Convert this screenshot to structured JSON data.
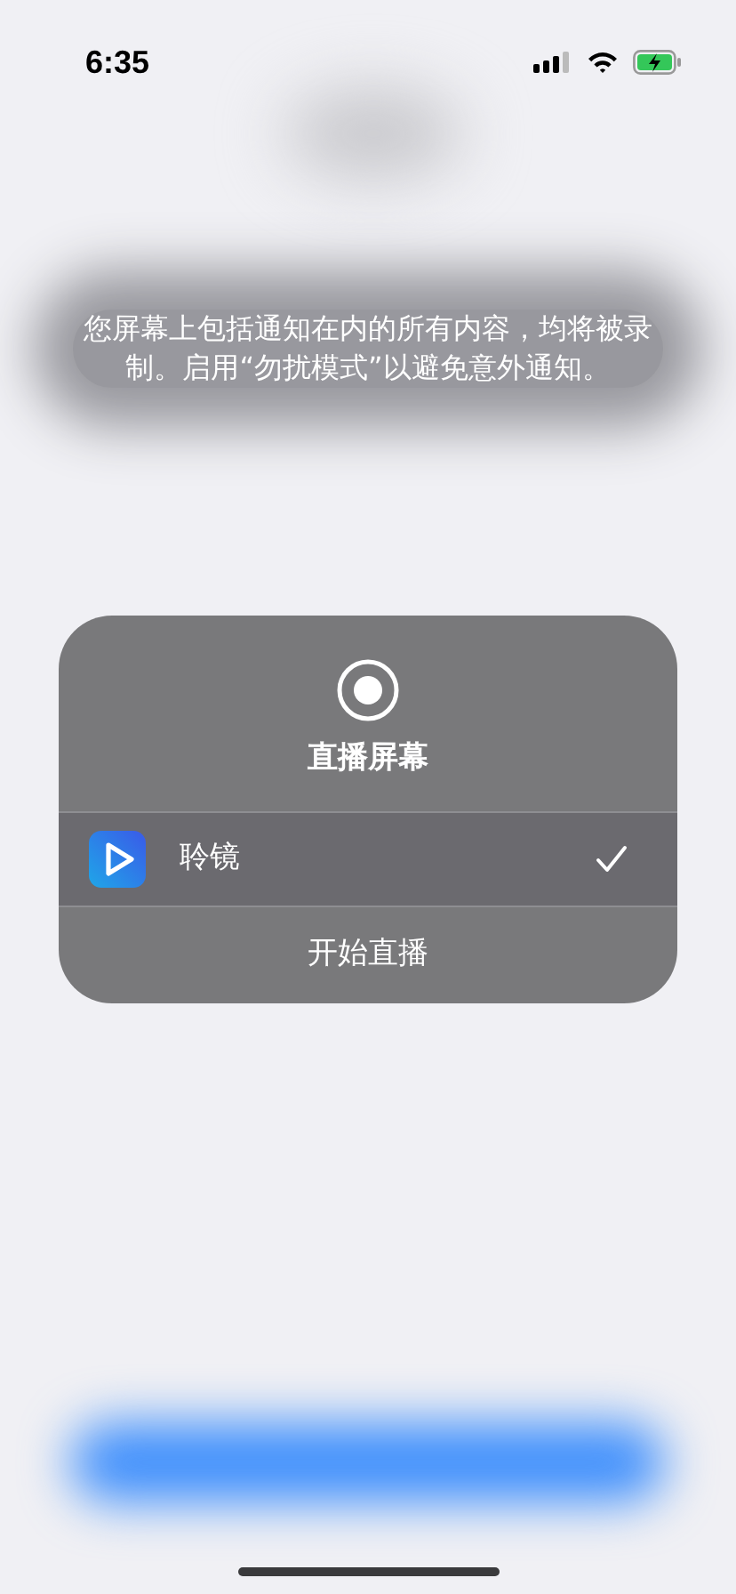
{
  "status_bar": {
    "time": "6:35"
  },
  "notice": "您屏幕上包括通知在内的所有内容，均将被录制。启用“勿扰模式”以避免意外通知。",
  "sheet": {
    "title": "直播屏幕",
    "apps": [
      {
        "name": "聆镜",
        "selected": true
      }
    ],
    "action": "开始直播"
  }
}
